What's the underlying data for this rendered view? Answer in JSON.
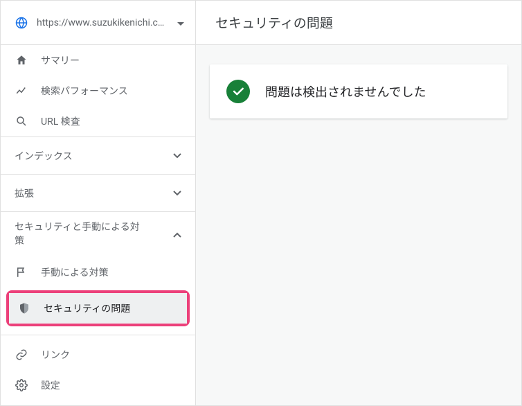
{
  "site": {
    "url": "https://www.suzukikenichi.co…"
  },
  "nav": {
    "summary": "サマリー",
    "performance": "検索パフォーマンス",
    "url_inspect": "URL 検査",
    "group_index": "インデックス",
    "group_enhance": "拡張",
    "group_security": "セキュリティと手動による対策",
    "manual_actions": "手動による対策",
    "security_issues": "セキュリティの問題",
    "links": "リンク",
    "settings": "設定"
  },
  "main": {
    "title": "セキュリティの問題",
    "status_message": "問題は検出されませんでした"
  }
}
